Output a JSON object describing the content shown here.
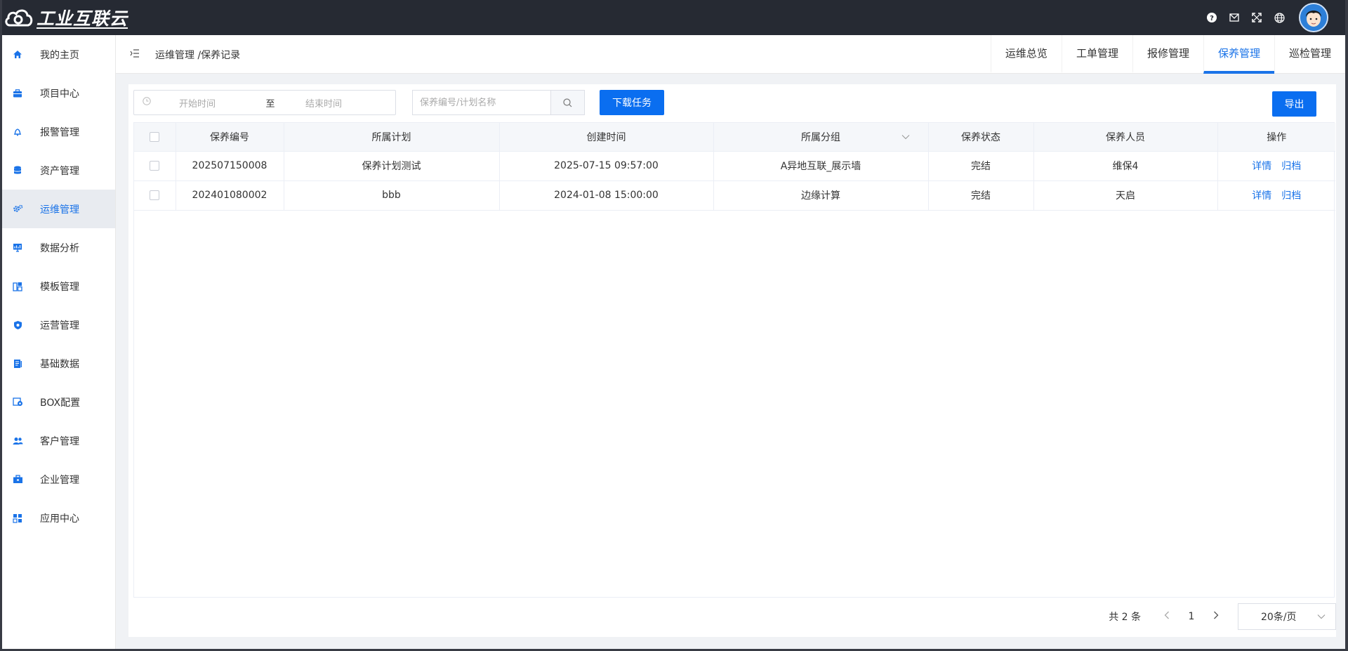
{
  "app": {
    "logo_text": "工业互联云"
  },
  "sidebar": {
    "items": [
      {
        "label": "我的主页",
        "icon": "home-icon"
      },
      {
        "label": "项目中心",
        "icon": "briefcase-icon"
      },
      {
        "label": "报警管理",
        "icon": "bell-icon"
      },
      {
        "label": "资产管理",
        "icon": "database-icon"
      },
      {
        "label": "运维管理",
        "icon": "gears-icon"
      },
      {
        "label": "数据分析",
        "icon": "monitor-chart-icon"
      },
      {
        "label": "模板管理",
        "icon": "template-icon"
      },
      {
        "label": "运营管理",
        "icon": "shield-icon"
      },
      {
        "label": "基础数据",
        "icon": "document-icon"
      },
      {
        "label": "BOX配置",
        "icon": "box-icon"
      },
      {
        "label": "客户管理",
        "icon": "users-icon"
      },
      {
        "label": "企业管理",
        "icon": "toolbox-icon"
      },
      {
        "label": "应用中心",
        "icon": "grid-icon"
      }
    ],
    "active_index": 4
  },
  "header": {
    "breadcrumb": "运维管理 /保养记录",
    "tabs": [
      "运维总览",
      "工单管理",
      "报修管理",
      "保养管理",
      "巡检管理"
    ],
    "active_tab": 3
  },
  "toolbar": {
    "date_start_placeholder": "开始时间",
    "date_separator": "至",
    "date_end_placeholder": "结束时间",
    "search_placeholder": "保养编号/计划名称",
    "download_label": "下载任务",
    "export_label": "导出"
  },
  "table": {
    "columns": [
      "保养编号",
      "所属计划",
      "创建时间",
      "所属分组",
      "保养状态",
      "保养人员",
      "操作"
    ],
    "rows": [
      {
        "id": "202507150008",
        "plan": "保养计划测试",
        "created": "2025-07-15 09:57:00",
        "group": "A异地互联_展示墙",
        "status": "完结",
        "person": "维保4",
        "action_detail": "详情",
        "action_archive": "归档"
      },
      {
        "id": "202401080002",
        "plan": "bbb",
        "created": "2024-01-08 15:00:00",
        "group": "边缘计算",
        "status": "完结",
        "person": "天启",
        "action_detail": "详情",
        "action_archive": "归档"
      }
    ]
  },
  "pagination": {
    "total_text": "共 2 条",
    "current_page": "1",
    "page_size": "20条/页"
  },
  "colors": {
    "accent": "#0a6ef0",
    "topbar": "#262a33"
  }
}
